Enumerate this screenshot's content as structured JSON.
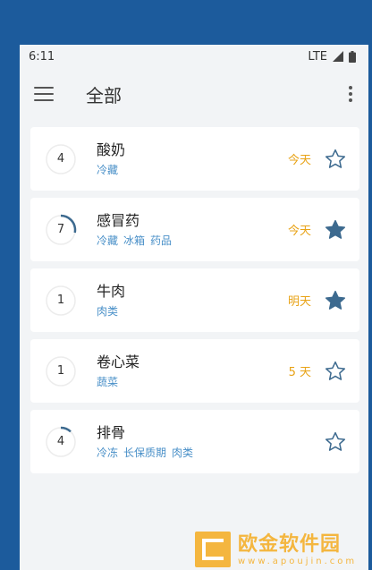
{
  "status": {
    "time": "6:11",
    "network": "LTE"
  },
  "appbar": {
    "title": "全部"
  },
  "items": [
    {
      "count": "4",
      "name": "酸奶",
      "tags": [
        "冷藏"
      ],
      "expire": "今天",
      "starred": false,
      "progress": 0
    },
    {
      "count": "7",
      "name": "感冒药",
      "tags": [
        "冷藏",
        "冰箱",
        "药品"
      ],
      "expire": "今天",
      "starred": true,
      "progress": 0.28
    },
    {
      "count": "1",
      "name": "牛肉",
      "tags": [
        "肉类"
      ],
      "expire": "明天",
      "starred": true,
      "progress": 0
    },
    {
      "count": "1",
      "name": "卷心菜",
      "tags": [
        "蔬菜"
      ],
      "expire": "5 天",
      "starred": false,
      "progress": 0
    },
    {
      "count": "4",
      "name": "排骨",
      "tags": [
        "冷冻",
        "长保质期",
        "肉类"
      ],
      "expire": "",
      "starred": false,
      "progress": 0.12
    }
  ],
  "watermark": {
    "main": "欧金软件园",
    "sub": "www.apoujin.com"
  },
  "colors": {
    "accent": "#4a90c8",
    "expire": "#e8a317",
    "star": "#3d6a8f",
    "frame": "#1c5b9c"
  }
}
